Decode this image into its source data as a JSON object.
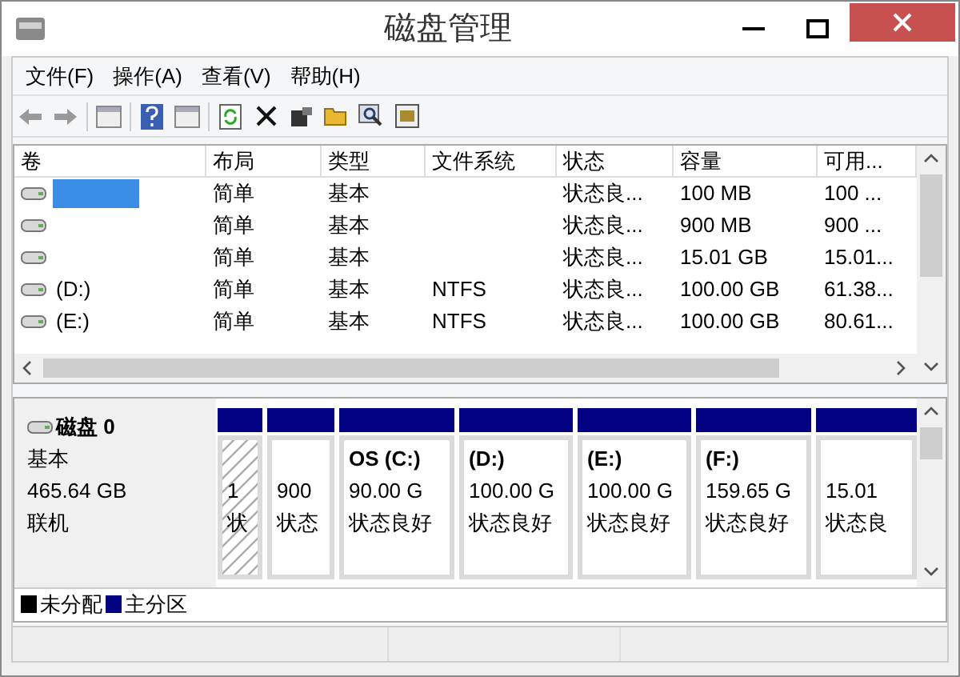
{
  "window": {
    "title": "磁盘管理"
  },
  "menu": [
    "文件(F)",
    "操作(A)",
    "查看(V)",
    "帮助(H)"
  ],
  "table": {
    "columns": [
      "卷",
      "布局",
      "类型",
      "文件系统",
      "状态",
      "容量",
      "可用..."
    ],
    "rows": [
      {
        "cells": [
          "",
          "简单",
          "基本",
          "",
          "状态良...",
          "100 MB",
          "100 ..."
        ],
        "selected": true
      },
      {
        "cells": [
          "",
          "简单",
          "基本",
          "",
          "状态良...",
          "900 MB",
          "900 ..."
        ],
        "selected": false
      },
      {
        "cells": [
          "",
          "简单",
          "基本",
          "",
          "状态良...",
          "15.01 GB",
          "15.01..."
        ],
        "selected": false
      },
      {
        "cells": [
          "(D:)",
          "简单",
          "基本",
          "NTFS",
          "状态良...",
          "100.00 GB",
          "61.38..."
        ],
        "selected": false
      },
      {
        "cells": [
          "(E:)",
          "简单",
          "基本",
          "NTFS",
          "状态良...",
          "100.00 GB",
          "80.61..."
        ],
        "selected": false
      }
    ]
  },
  "disk": {
    "name": "磁盘 0",
    "type": "基本",
    "size": "465.64 GB",
    "status": "联机",
    "partitions": [
      {
        "kind": "primary",
        "selected": true,
        "lines": [
          "1",
          "状"
        ]
      },
      {
        "kind": "primary",
        "selected": false,
        "lines": [
          "900",
          "状态"
        ]
      },
      {
        "kind": "primary",
        "selected": false,
        "title": "OS  (C:)",
        "lines": [
          "90.00 G",
          "状态良好"
        ]
      },
      {
        "kind": "primary",
        "selected": false,
        "title": "(D:)",
        "lines": [
          "100.00 G",
          "状态良好"
        ]
      },
      {
        "kind": "primary",
        "selected": false,
        "title": "(E:)",
        "lines": [
          "100.00 G",
          "状态良好"
        ]
      },
      {
        "kind": "primary",
        "selected": false,
        "title": "(F:)",
        "lines": [
          "159.65 G",
          "状态良好"
        ]
      },
      {
        "kind": "primary",
        "selected": false,
        "lines": [
          "15.01",
          "状态良"
        ]
      }
    ]
  },
  "legend": [
    {
      "label": "未分配",
      "color": "#000000"
    },
    {
      "label": "主分区",
      "color": "#000080"
    }
  ]
}
